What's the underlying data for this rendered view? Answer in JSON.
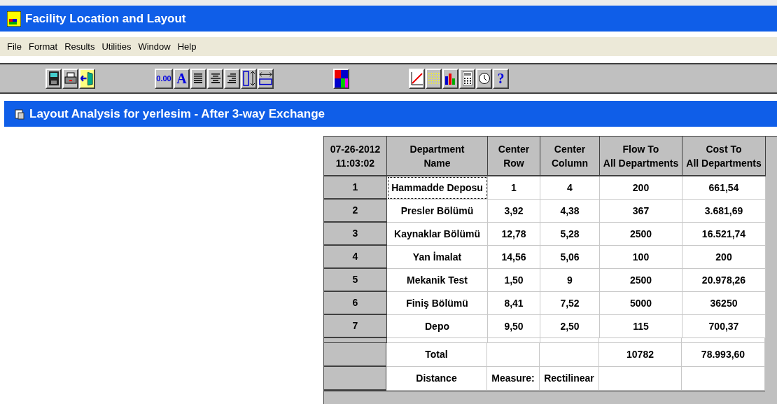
{
  "window": {
    "title": "Facility Location and Layout"
  },
  "menu": [
    "File",
    "Format",
    "Results",
    "Utilities",
    "Window",
    "Help"
  ],
  "toolbar": [
    [
      {
        "kind": "save"
      },
      {
        "kind": "print"
      },
      {
        "kind": "exit"
      }
    ],
    [
      {
        "kind": "text",
        "label": "0.00"
      },
      {
        "kind": "text",
        "label": "A"
      },
      {
        "kind": "align-left"
      },
      {
        "kind": "align-center"
      },
      {
        "kind": "align-right"
      },
      {
        "kind": "row-height"
      },
      {
        "kind": "column-width"
      }
    ],
    [
      {
        "kind": "colors"
      }
    ],
    [
      {
        "kind": "line-chart"
      },
      {
        "kind": "grid"
      },
      {
        "kind": "bar-chart"
      },
      {
        "kind": "calculator"
      },
      {
        "kind": "clock"
      },
      {
        "kind": "text",
        "label": "?"
      }
    ]
  ],
  "document": {
    "title": "Layout Analysis for yerlesim - After 3-way Exchange"
  },
  "table": {
    "corner": "07-26-2012\n11:03:02",
    "columns": [
      "Department\nName",
      "Center\nRow",
      "Center\nColumn",
      "Flow To\nAll Departments",
      "Cost To\nAll Departments"
    ],
    "rows": [
      {
        "index": "1",
        "cells": [
          "Hammadde Deposu",
          "1",
          "4",
          "200",
          "661,54"
        ],
        "focused": true
      },
      {
        "index": "2",
        "cells": [
          "Presler Bölümü",
          "3,92",
          "4,38",
          "367",
          "3.681,69"
        ],
        "focused": false
      },
      {
        "index": "3",
        "cells": [
          "Kaynaklar Bölümü",
          "12,78",
          "5,28",
          "2500",
          "16.521,74"
        ],
        "focused": false
      },
      {
        "index": "4",
        "cells": [
          "Yan İmalat",
          "14,56",
          "5,06",
          "100",
          "200"
        ],
        "focused": false
      },
      {
        "index": "5",
        "cells": [
          "Mekanik Test",
          "1,50",
          "9",
          "2500",
          "20.978,26"
        ],
        "focused": false
      },
      {
        "index": "6",
        "cells": [
          "Finiş Bölümü",
          "8,41",
          "7,52",
          "5000",
          "36250"
        ],
        "focused": false
      },
      {
        "index": "7",
        "cells": [
          "Depo",
          "9,50",
          "2,50",
          "115",
          "700,37"
        ],
        "focused": false
      }
    ],
    "summary": [
      {
        "label": "Total",
        "flow": "10782",
        "cost": "78.993,60"
      },
      {
        "label": "Distance",
        "center_row": "Measure:",
        "center_column": "Rectilinear"
      }
    ]
  }
}
